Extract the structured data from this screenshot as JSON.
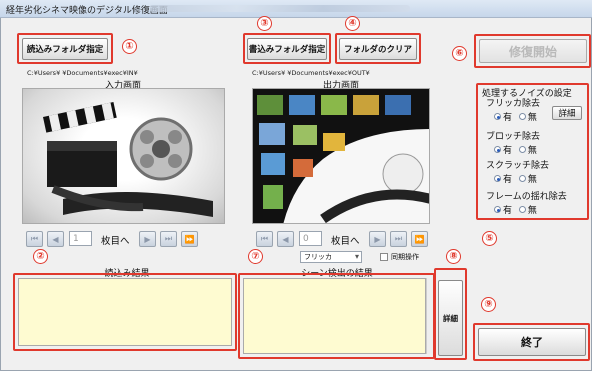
{
  "window": {
    "title": "経年劣化シネマ映像のデジタル修復画面"
  },
  "input": {
    "folder_button": "読込みフォルダ指定",
    "path": "C:¥Users¥        ¥Documents¥exec¥IN¥",
    "caption": "入力画面",
    "page_value": "1",
    "page_suffix": "枚目へ",
    "result_caption": "読込み結果"
  },
  "output": {
    "folder_button": "書込みフォルダ指定",
    "clear_button": "フォルダのクリア",
    "path": "C:¥Users¥        ¥Documents¥exec¥OUT¥",
    "caption": "出力画面",
    "page_value": "0",
    "page_suffix": "枚目へ",
    "mode_select": "フリッカ",
    "sync_label": "同期操作",
    "scene_caption": "シーン検出の結果",
    "detail_button": "詳細"
  },
  "start_button": "修復開始",
  "end_button": "終了",
  "noise": {
    "title": "処理するノイズの設定",
    "flicker": {
      "label": "フリッカ除去",
      "on": "有",
      "off": "無",
      "detail": "詳細"
    },
    "blotch": {
      "label": "ブロッチ除去",
      "on": "有",
      "off": "無"
    },
    "scratch": {
      "label": "スクラッチ除去",
      "on": "有",
      "off": "無"
    },
    "shake": {
      "label": "フレームの揺れ除去",
      "on": "有",
      "off": "無"
    }
  },
  "markers": [
    "①",
    "②",
    "③",
    "④",
    "⑤",
    "⑥",
    "⑦",
    "⑧",
    "⑨"
  ],
  "colors": {
    "marker": "#e0392d",
    "result_bg": "#fefbd1"
  },
  "icons": [
    "first-frame-icon",
    "prev-frame-icon",
    "next-frame-icon",
    "last-frame-icon",
    "fast-forward-icon",
    "rewind-icon"
  ]
}
